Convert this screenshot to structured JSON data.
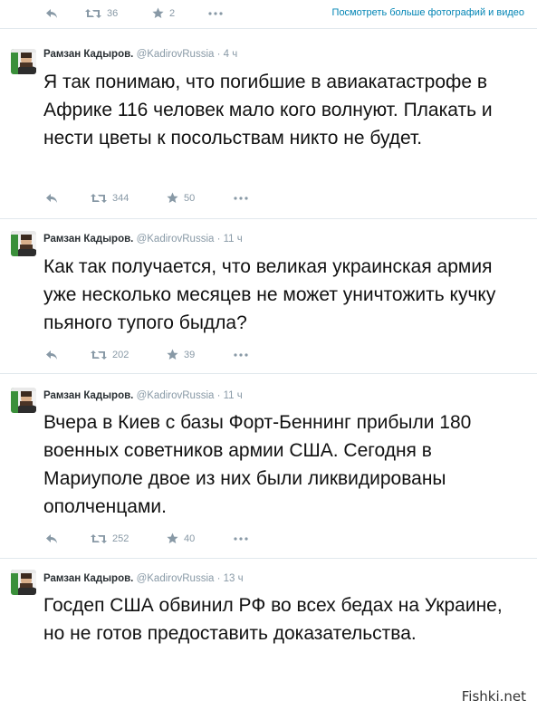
{
  "top": {
    "retweets": "36",
    "favorites": "2",
    "more_photos_link": "Посмотреть больше фотографий и видео"
  },
  "tweets": [
    {
      "name": "Рамзан Кадыров.",
      "handle": "@KadirovRussia",
      "time": "· 4 ч",
      "text": "Я так понимаю, что погибшие в авиакатастрофе в Африке 116 человек мало кого волнуют. Плакать и нести цветы к посольствам никто не будет.",
      "retweets": "344",
      "favorites": "50"
    },
    {
      "name": "Рамзан Кадыров.",
      "handle": "@KadirovRussia",
      "time": "· 11 ч",
      "text": "Как так получается, что великая украинская армия уже несколько месяцев не может уничтожить кучку пьяного тупого быдла?",
      "retweets": "202",
      "favorites": "39"
    },
    {
      "name": "Рамзан Кадыров.",
      "handle": "@KadirovRussia",
      "time": "· 11 ч",
      "text": "Вчера в Киев с базы Форт-Беннинг прибыли 180 военных советников армии США. Сегодня в Мариуполе двое из них были ликвидированы ополченцами.",
      "retweets": "252",
      "favorites": "40"
    },
    {
      "name": "Рамзан Кадыров.",
      "handle": "@KadirovRussia",
      "time": "· 13 ч",
      "text": "Госдеп США обвинил РФ во всех бедах на Украине, но не готов предоставить доказательства.",
      "retweets": "",
      "favorites": ""
    }
  ],
  "watermark": "Fishki.net",
  "colors": {
    "icon_gray": "#8899a6",
    "link_blue": "#0084b4",
    "divider": "#e1e8ed",
    "text": "#111111"
  },
  "icons": [
    "reply-icon",
    "retweet-icon",
    "favorite-icon",
    "more-icon"
  ]
}
